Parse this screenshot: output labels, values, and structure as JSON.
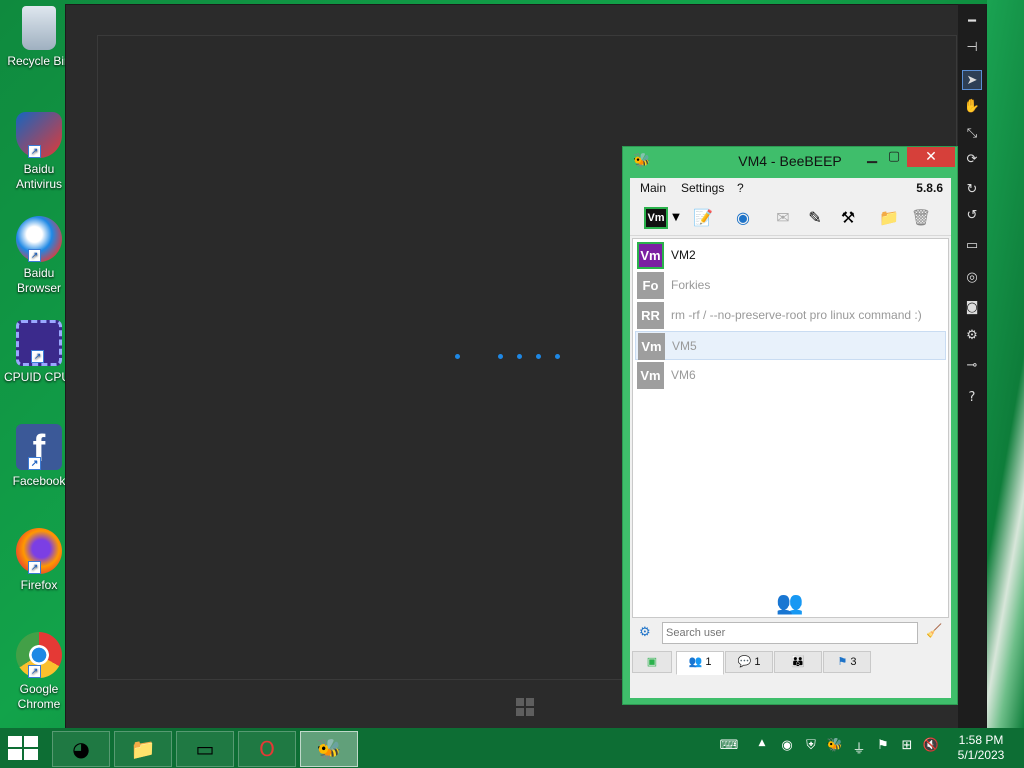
{
  "desktop": {
    "icons": [
      {
        "label": "Recycle Bin",
        "icon": "recycle-bin-icon"
      },
      {
        "label": "Baidu Antivirus",
        "icon": "baidu-antivirus-icon"
      },
      {
        "label": "Baidu Browser",
        "icon": "baidu-browser-icon"
      },
      {
        "label": "CPUID CPU-",
        "icon": "cpuid-icon"
      },
      {
        "label": "Facebook",
        "icon": "facebook-icon"
      },
      {
        "label": "Firefox",
        "icon": "firefox-icon"
      },
      {
        "label": "Google Chrome",
        "icon": "chrome-icon"
      }
    ]
  },
  "beebeep": {
    "title": "VM4 - BeeBEEP",
    "close_glyph": "✕",
    "menu": {
      "main": "Main",
      "settings": "Settings",
      "help": "?"
    },
    "version": "5.8.6",
    "toolbar": {
      "vm_label": "Vm"
    },
    "users": [
      {
        "avatar": "Vm",
        "name": "VM2",
        "online": true
      },
      {
        "avatar": "Fo",
        "name": "Forkies",
        "online": false
      },
      {
        "avatar": "RR",
        "name": "rm -rf / --no-preserve-root pro linux command :)",
        "online": false
      },
      {
        "avatar": "Vm",
        "name": "VM5",
        "online": false,
        "selected": true
      },
      {
        "avatar": "Vm",
        "name": "VM6",
        "online": false
      }
    ],
    "search": {
      "placeholder": "Search user"
    },
    "tabs": [
      {
        "count": "",
        "icon": "screen-icon"
      },
      {
        "count": "1",
        "icon": "users-icon"
      },
      {
        "count": "1",
        "icon": "chat-icon"
      },
      {
        "count": "",
        "icon": "groups-icon"
      },
      {
        "count": "3",
        "icon": "share-icon"
      }
    ]
  },
  "taskbar": {
    "clock_time": "1:58 PM",
    "clock_date": "5/1/2023"
  },
  "colors": {
    "accent_green": "#3fbe6b",
    "close_red": "#d6403a",
    "online_avatar": "#7b1fa2",
    "offline_avatar": "#9e9e9e",
    "spinner_blue": "#1e88e5"
  }
}
